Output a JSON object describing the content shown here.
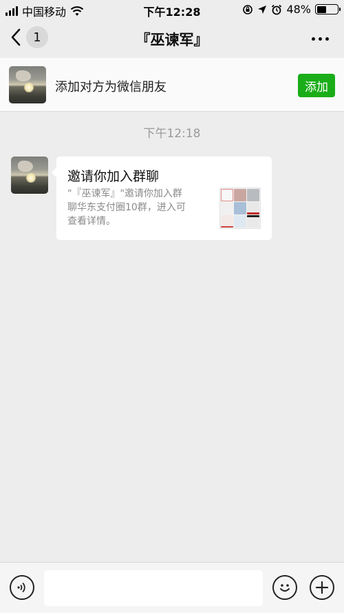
{
  "status_bar": {
    "carrier": "中国移动",
    "time": "下午12:28",
    "battery_percent": "48%",
    "battery_level": 0.48
  },
  "nav": {
    "unread_count": "1",
    "title": "『巫谏军』"
  },
  "add_friend_bar": {
    "text": "添加对方为微信朋友",
    "button_label": "添加"
  },
  "chat": {
    "timestamp": "下午12:18",
    "invite_card": {
      "title": "邀请你加入群聊",
      "description": "\"『巫谏军』\"邀请你加入群\n聊华东支付圈10群，进入可\n查看详情。"
    }
  },
  "colors": {
    "accent_green": "#1aad19",
    "background": "#ededed"
  }
}
